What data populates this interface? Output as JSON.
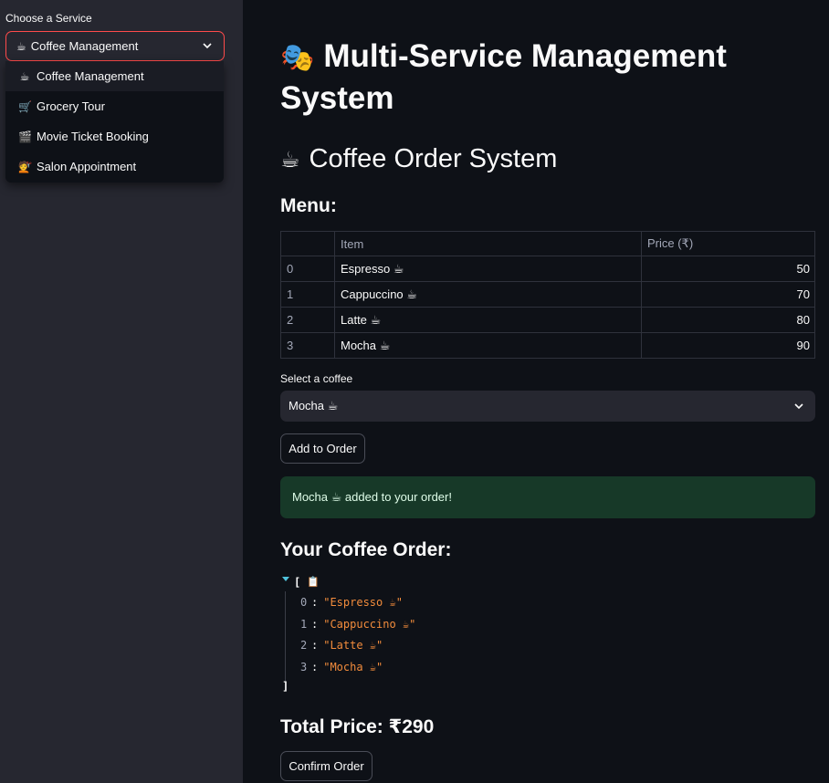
{
  "sidebar": {
    "label": "Choose a Service",
    "selected": {
      "icon": "☕",
      "label": "Coffee Management"
    },
    "options": [
      {
        "icon": "☕",
        "label": "Coffee Management"
      },
      {
        "icon": "🛒",
        "label": "Grocery Tour"
      },
      {
        "icon": "🎬",
        "label": "Movie Ticket Booking"
      },
      {
        "icon": "💇",
        "label": "Salon Appointment"
      }
    ]
  },
  "main": {
    "title_icon": "🎭",
    "title": "Multi-Service Management System",
    "subtitle_icon": "☕",
    "subtitle": "Coffee Order System",
    "menu_heading": "Menu:",
    "table": {
      "columns": [
        "",
        "Item",
        "Price (₹)"
      ],
      "rows": [
        {
          "index": "0",
          "item": "Espresso ☕",
          "price": "50"
        },
        {
          "index": "1",
          "item": "Cappuccino ☕",
          "price": "70"
        },
        {
          "index": "2",
          "item": "Latte ☕",
          "price": "80"
        },
        {
          "index": "3",
          "item": "Mocha ☕",
          "price": "90"
        }
      ]
    },
    "select_label": "Select a coffee",
    "select_value": "Mocha ☕",
    "add_button": "Add to Order",
    "success_message": "Mocha ☕  added to your order!",
    "order_heading": "Your Coffee Order:",
    "order_json": {
      "open": "[",
      "close": "]",
      "items": [
        {
          "key": "0",
          "value": "\"Espresso ☕\""
        },
        {
          "key": "1",
          "value": "\"Cappuccino ☕\""
        },
        {
          "key": "2",
          "value": "\"Latte ☕\""
        },
        {
          "key": "3",
          "value": "\"Mocha ☕\""
        }
      ]
    },
    "total_text": "Total Price: ₹290",
    "confirm_button": "Confirm Order"
  },
  "colors": {
    "accent": "#ff4b4b",
    "success_bg": "#173928",
    "json_string": "#f28c3c",
    "background": "#0e1117",
    "sidebar_bg": "#262730"
  },
  "icons": {
    "chevron": "chevron-down-icon",
    "copy": "clipboard-icon",
    "collapse": "collapse-caret-icon"
  }
}
